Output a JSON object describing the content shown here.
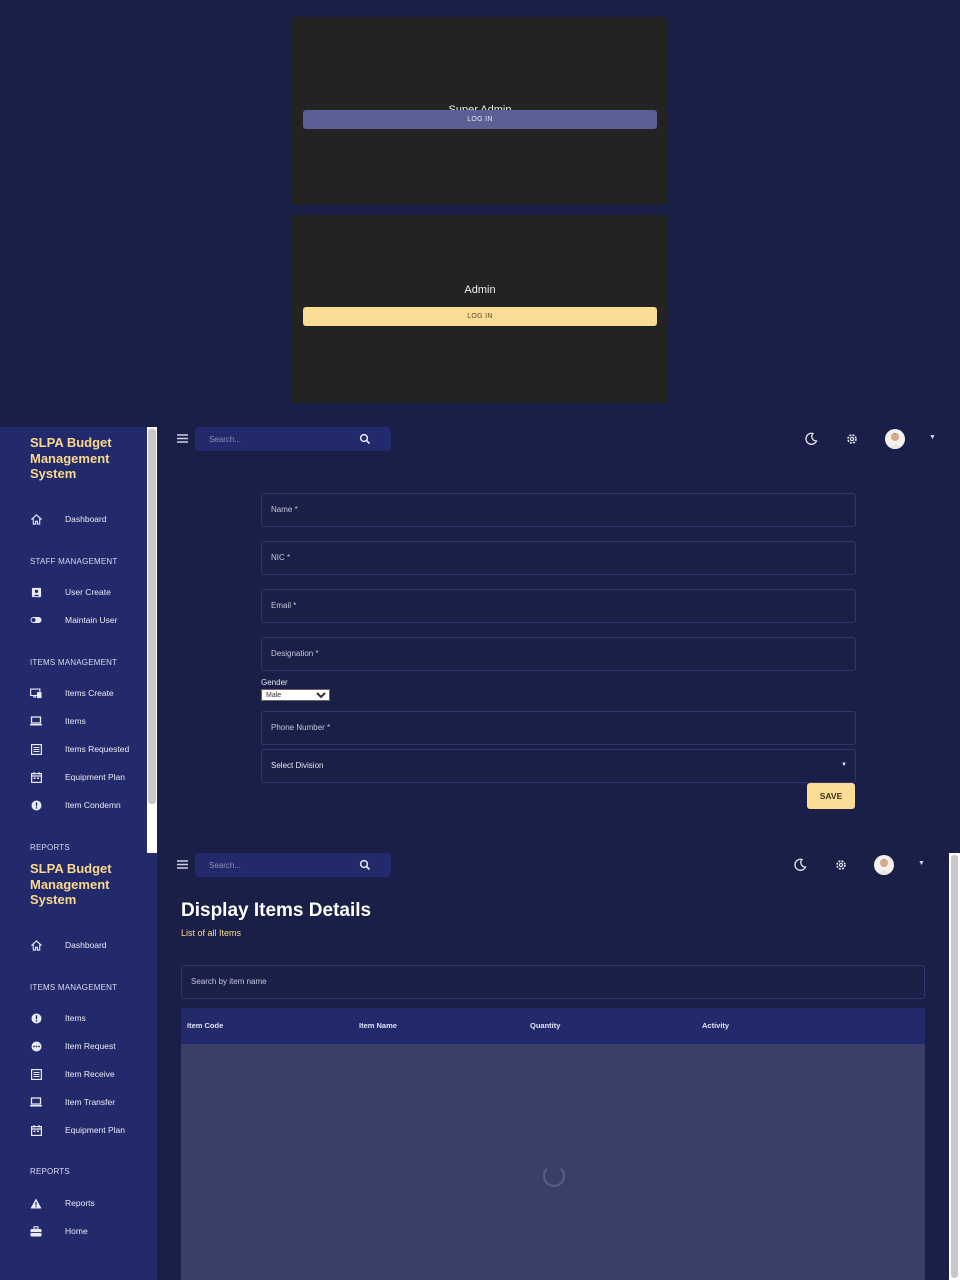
{
  "login_cards": [
    {
      "role": "Super Admin",
      "button_label": "LOG IN"
    },
    {
      "role": "Admin",
      "button_label": "LOG IN"
    }
  ],
  "app": {
    "brand": "SLPA Budget Management System"
  },
  "screen2": {
    "search_placeholder": "Search...",
    "sidebar": {
      "dashboard": "Dashboard",
      "staff_section": "STAFF MANAGEMENT",
      "user_create": "User Create",
      "maintain_user": "Maintain User",
      "items_section": "ITEMS MANAGEMENT",
      "items_create": "Items Create",
      "items": "Items",
      "items_requested": "Items Requested",
      "equipment_plan": "Equipment Plan",
      "item_condemn": "Item Condemn",
      "reports_section": "REPORTS"
    },
    "form": {
      "name": "Name *",
      "nic": "NIC *",
      "email": "Email *",
      "designation": "Designation *",
      "gender_label": "Gender",
      "gender_value": "Male",
      "phone": "Phone Number *",
      "division": "Select Division",
      "save": "SAVE"
    }
  },
  "screen3": {
    "search_placeholder": "Search...",
    "sidebar": {
      "dashboard": "Dashboard",
      "items_section": "ITEMS MANAGEMENT",
      "items": "Items",
      "item_request": "Item Request",
      "item_receive": "Item Receive",
      "item_transfer": "Item Transfer",
      "equipment_plan": "Equipment Plan",
      "reports_section": "REPORTS",
      "reports": "Reports",
      "home": "Home"
    },
    "title": "Display Items Details",
    "subtitle": "List of all Items",
    "item_search_placeholder": "Search by item name",
    "table_headers": [
      "Item Code",
      "Item Name",
      "Quantity",
      "Activity"
    ]
  },
  "colors": {
    "background": "#1a1f47",
    "sidebar": "#232a6b",
    "accent": "#fbdc94",
    "login_button": "#5b5f94"
  },
  "icons": [
    "menu-icon",
    "search-icon",
    "moon-icon",
    "gear-icon",
    "avatar",
    "home-icon",
    "contact-icon",
    "toggle-icon",
    "monitor-icon",
    "laptop-icon",
    "list-icon",
    "calendar-icon",
    "alert-icon",
    "dots-icon",
    "warning-icon",
    "briefcase-icon"
  ]
}
